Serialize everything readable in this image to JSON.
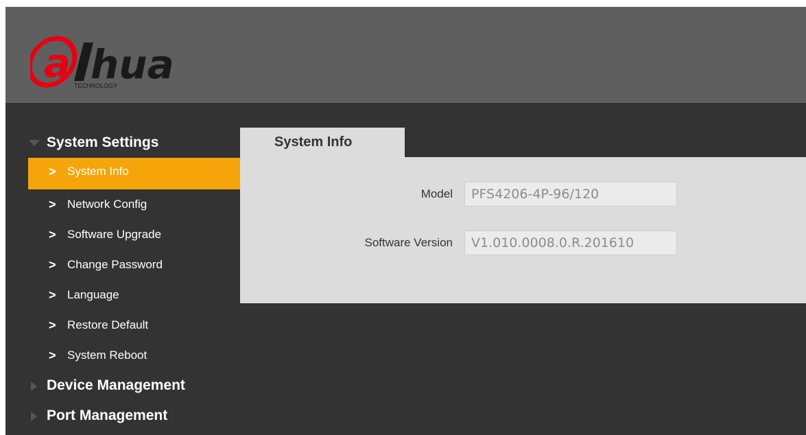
{
  "brand": {
    "logo_text": "alhua",
    "logo_subtext": "TECHNOLOGY",
    "logo_colors": {
      "red": "#e60012",
      "black": "#1a1a1a"
    }
  },
  "colors": {
    "header_bg": "#5f5f5f",
    "body_bg": "#333333",
    "active_item": "#f5a50a",
    "panel_bg": "#dcdcdc"
  },
  "sidebar": {
    "groups": [
      {
        "label": "System Settings",
        "icon": "triangle-down-icon",
        "expanded": true,
        "items": [
          {
            "label": "System Info",
            "active": true
          },
          {
            "label": "Network Config",
            "active": false
          },
          {
            "label": "Software Upgrade",
            "active": false
          },
          {
            "label": "Change Password",
            "active": false
          },
          {
            "label": "Language",
            "active": false
          },
          {
            "label": "Restore Default",
            "active": false
          },
          {
            "label": "System Reboot",
            "active": false
          }
        ]
      },
      {
        "label": "Device Management",
        "icon": "triangle-right-icon",
        "expanded": false
      },
      {
        "label": "Port Management",
        "icon": "triangle-right-icon",
        "expanded": false
      }
    ],
    "item_icon": "chevron-right-icon"
  },
  "main": {
    "tab_label": "System Info",
    "fields": {
      "model": {
        "label": "Model",
        "value": "PFS4206-4P-96/120"
      },
      "software_version": {
        "label": "Software Version",
        "value": "V1.010.0008.0.R.201610"
      }
    }
  }
}
